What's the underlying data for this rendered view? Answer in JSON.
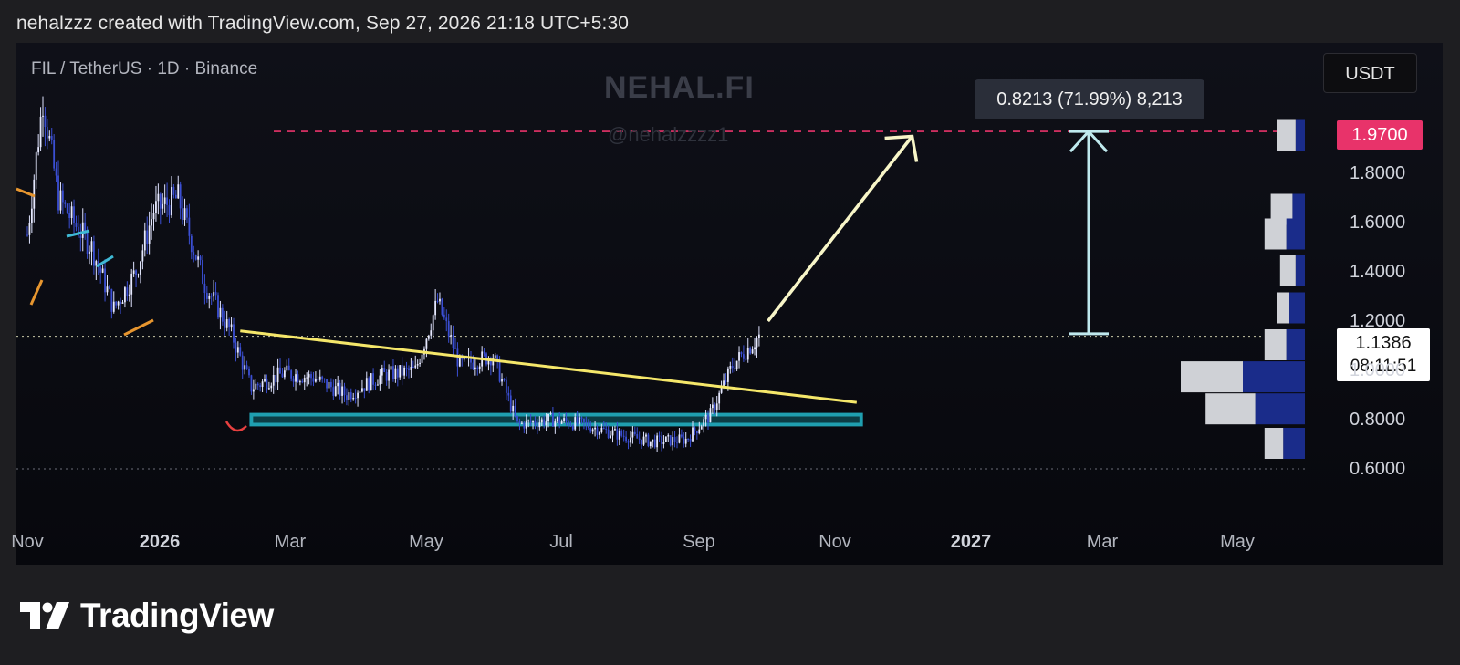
{
  "header": {
    "credit": "nehalzzz created with TradingView.com, Sep 27, 2026 21:18 UTC+5:30"
  },
  "chart": {
    "symbol": "FIL / TetherUS · 1D · Binance",
    "watermark_title": "NEHAL.FI",
    "watermark_handle": "@nehalzzzz1",
    "currency": "USDT",
    "measure_tooltip": "0.8213 (71.99%) 8,213",
    "target_price": "1.9700",
    "current_price": "1.1386",
    "countdown": "08:11:51",
    "price_axis_labels": [
      "1.8000",
      "1.6000",
      "1.4000",
      "1.2000",
      "1.0000",
      "0.8000",
      "0.6000"
    ],
    "time_axis_labels": [
      "Nov",
      "2026",
      "Mar",
      "May",
      "Jul",
      "Sep",
      "Nov",
      "2027",
      "Mar",
      "May"
    ]
  },
  "footer": {
    "brand": "TradingView"
  },
  "colors": {
    "candle": "#3b4fd4",
    "trendline": "#f5e76a",
    "support": "#1f9fb0",
    "target_line": "#e8336a",
    "measure_arrow": "#bfe9ee",
    "projection_arrow": "#f8f6c8"
  },
  "chart_data": {
    "type": "candlestick",
    "title": "",
    "symbol": "FIL / TetherUS",
    "interval": "1D",
    "exchange": "Binance",
    "currency": "USDT",
    "ylim": [
      0.55,
      2.2
    ],
    "price_ticks": [
      0.6,
      0.8,
      1.0,
      1.2,
      1.4,
      1.6,
      1.8
    ],
    "x_ticks": [
      "Nov",
      "2026",
      "Mar",
      "May",
      "Jul",
      "Sep",
      "Nov",
      "2027",
      "Mar",
      "May"
    ],
    "close_path": [
      {
        "date": "2025-11-01",
        "price": 1.55
      },
      {
        "date": "2025-11-08",
        "price": 2.1
      },
      {
        "date": "2025-11-15",
        "price": 1.7
      },
      {
        "date": "2025-11-22",
        "price": 1.6
      },
      {
        "date": "2025-11-30",
        "price": 1.5
      },
      {
        "date": "2025-12-10",
        "price": 1.25
      },
      {
        "date": "2025-12-20",
        "price": 1.4
      },
      {
        "date": "2025-12-28",
        "price": 1.65
      },
      {
        "date": "2026-01-08",
        "price": 1.7
      },
      {
        "date": "2026-01-20",
        "price": 1.35
      },
      {
        "date": "2026-02-01",
        "price": 1.15
      },
      {
        "date": "2026-02-10",
        "price": 0.93
      },
      {
        "date": "2026-02-25",
        "price": 0.99
      },
      {
        "date": "2026-03-10",
        "price": 0.97
      },
      {
        "date": "2026-03-25",
        "price": 0.9
      },
      {
        "date": "2026-04-10",
        "price": 0.98
      },
      {
        "date": "2026-04-25",
        "price": 1.0
      },
      {
        "date": "2026-05-05",
        "price": 1.28
      },
      {
        "date": "2026-05-15",
        "price": 1.02
      },
      {
        "date": "2026-05-30",
        "price": 1.06
      },
      {
        "date": "2026-06-10",
        "price": 0.78
      },
      {
        "date": "2026-06-25",
        "price": 0.8
      },
      {
        "date": "2026-07-10",
        "price": 0.78
      },
      {
        "date": "2026-07-25",
        "price": 0.74
      },
      {
        "date": "2026-08-10",
        "price": 0.71
      },
      {
        "date": "2026-08-25",
        "price": 0.72
      },
      {
        "date": "2026-09-05",
        "price": 0.82
      },
      {
        "date": "2026-09-15",
        "price": 1.02
      },
      {
        "date": "2026-09-27",
        "price": 1.1386
      }
    ],
    "annotations": {
      "descending_trendline": {
        "from": {
          "date": "2026-02-05",
          "price": 1.16
        },
        "to": {
          "date": "2026-11-10",
          "price": 0.87
        }
      },
      "support_zone": {
        "from_date": "2026-02-10",
        "to_date": "2026-11-12",
        "low": 0.78,
        "high": 0.82
      },
      "target_line": 1.97,
      "current_price_line": 1.1386,
      "measure": {
        "from_price": 1.1487,
        "to_price": 1.97,
        "change": 0.8213,
        "percent": 71.99,
        "ticks": 8213
      },
      "projection_arrow": {
        "from": {
          "date": "2026-10-01",
          "price": 1.2
        },
        "to": {
          "date": "2026-12-05",
          "price": 1.95
        }
      }
    },
    "volume_profile": [
      {
        "price": 1.95,
        "up": 0.3,
        "down": 0.15
      },
      {
        "price": 1.65,
        "up": 0.35,
        "down": 0.2
      },
      {
        "price": 1.55,
        "up": 0.35,
        "down": 0.3
      },
      {
        "price": 1.4,
        "up": 0.25,
        "down": 0.15
      },
      {
        "price": 1.25,
        "up": 0.2,
        "down": 0.25
      },
      {
        "price": 1.1,
        "up": 0.35,
        "down": 0.3
      },
      {
        "price": 0.97,
        "up": 1.0,
        "down": 1.0
      },
      {
        "price": 0.84,
        "up": 0.8,
        "down": 0.8
      },
      {
        "price": 0.7,
        "up": 0.3,
        "down": 0.35
      }
    ]
  }
}
